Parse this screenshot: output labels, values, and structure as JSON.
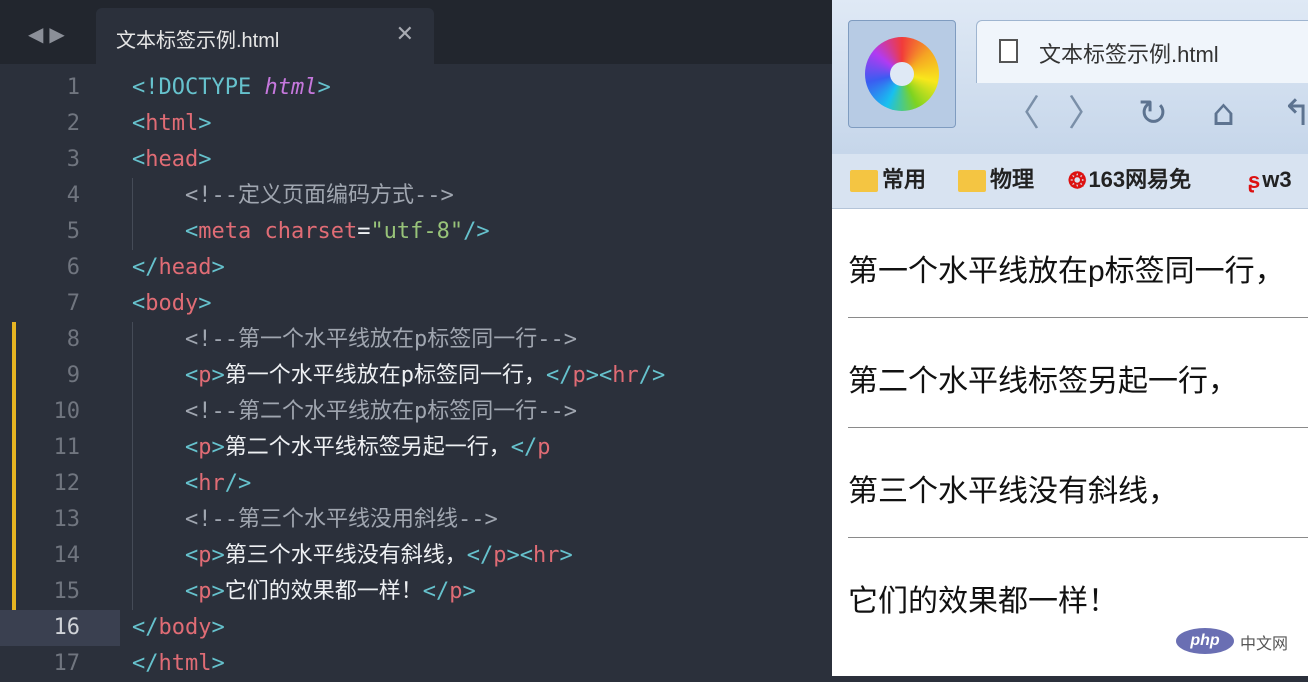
{
  "editor": {
    "tab_title": "文本标签示例.html",
    "line_numbers": [
      "1",
      "2",
      "3",
      "4",
      "5",
      "6",
      "7",
      "8",
      "9",
      "10",
      "11",
      "12",
      "13",
      "14",
      "15",
      "16",
      "17"
    ],
    "current_line": "16",
    "code": {
      "l1_doctype": "<!DOCTYPE",
      "l1_html": "html",
      "lt": "<",
      "gt": ">",
      "close_lt": "</",
      "self_close": "/>",
      "html_tag": "html",
      "head_tag": "head",
      "body_tag": "body",
      "meta_tag": "meta",
      "charset_attr": "charset",
      "eq": "=",
      "charset_val": "\"utf-8\"",
      "p_tag": "p",
      "hr_tag": "hr",
      "c4": "<!--定义页面编码方式-->",
      "c8": "<!--第一个水平线放在p标签同一行-->",
      "c10": "<!--第二个水平线放在p标签同一行-->",
      "c13": "<!--第三个水平线没用斜线-->",
      "t9": "第一个水平线放在p标签同一行，",
      "t11": "第二个水平线标签另起一行，",
      "t14": "第三个水平线没有斜线，",
      "t15": "它们的效果都一样！"
    }
  },
  "browser": {
    "tab_title": "文本标签示例.html",
    "bookmarks": [
      "常用",
      "物理",
      "163网易免",
      "w3"
    ],
    "paragraphs": [
      "第一个水平线放在p标签同一行，",
      "第二个水平线标签另起一行，",
      "第三个水平线没有斜线，",
      "它们的效果都一样！"
    ]
  },
  "watermark": {
    "logo": "php",
    "text": "中文网"
  },
  "icons": [
    "back-arrow-icon",
    "forward-arrow-icon",
    "close-icon",
    "document-icon",
    "refresh-icon",
    "home-icon",
    "folder-icon"
  ]
}
